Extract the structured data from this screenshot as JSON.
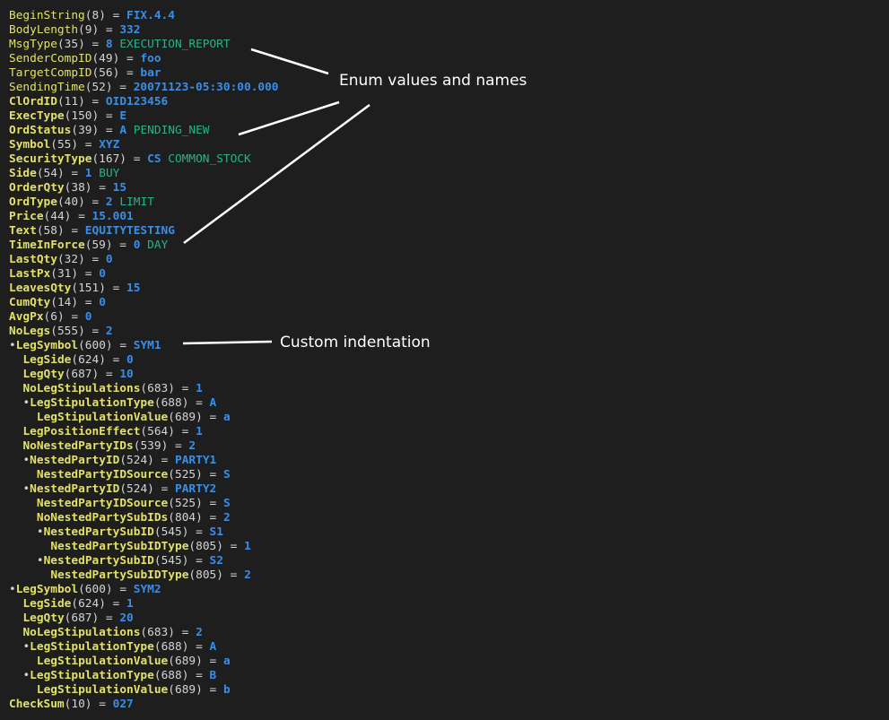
{
  "lines": [
    {
      "indent": 0,
      "bullet": false,
      "bold": false,
      "tag": "BeginString",
      "num": "8",
      "value": "FIX.4.4",
      "ename": ""
    },
    {
      "indent": 0,
      "bullet": false,
      "bold": false,
      "tag": "BodyLength",
      "num": "9",
      "value": "332",
      "ename": ""
    },
    {
      "indent": 0,
      "bullet": false,
      "bold": false,
      "tag": "MsgType",
      "num": "35",
      "value": "8",
      "ename": "EXECUTION_REPORT"
    },
    {
      "indent": 0,
      "bullet": false,
      "bold": false,
      "tag": "SenderCompID",
      "num": "49",
      "value": "foo",
      "ename": ""
    },
    {
      "indent": 0,
      "bullet": false,
      "bold": false,
      "tag": "TargetCompID",
      "num": "56",
      "value": "bar",
      "ename": ""
    },
    {
      "indent": 0,
      "bullet": false,
      "bold": false,
      "tag": "SendingTime",
      "num": "52",
      "value": "20071123-05:30:00.000",
      "ename": ""
    },
    {
      "indent": 0,
      "bullet": false,
      "bold": true,
      "tag": "ClOrdID",
      "num": "11",
      "value": "OID123456",
      "ename": ""
    },
    {
      "indent": 0,
      "bullet": false,
      "bold": true,
      "tag": "ExecType",
      "num": "150",
      "value": "E",
      "ename": ""
    },
    {
      "indent": 0,
      "bullet": false,
      "bold": true,
      "tag": "OrdStatus",
      "num": "39",
      "value": "A",
      "ename": "PENDING_NEW"
    },
    {
      "indent": 0,
      "bullet": false,
      "bold": true,
      "tag": "Symbol",
      "num": "55",
      "value": "XYZ",
      "ename": ""
    },
    {
      "indent": 0,
      "bullet": false,
      "bold": true,
      "tag": "SecurityType",
      "num": "167",
      "value": "CS",
      "ename": "COMMON_STOCK"
    },
    {
      "indent": 0,
      "bullet": false,
      "bold": true,
      "tag": "Side",
      "num": "54",
      "value": "1",
      "ename": "BUY"
    },
    {
      "indent": 0,
      "bullet": false,
      "bold": true,
      "tag": "OrderQty",
      "num": "38",
      "value": "15",
      "ename": ""
    },
    {
      "indent": 0,
      "bullet": false,
      "bold": true,
      "tag": "OrdType",
      "num": "40",
      "value": "2",
      "ename": "LIMIT"
    },
    {
      "indent": 0,
      "bullet": false,
      "bold": true,
      "tag": "Price",
      "num": "44",
      "value": "15.001",
      "ename": ""
    },
    {
      "indent": 0,
      "bullet": false,
      "bold": true,
      "tag": "Text",
      "num": "58",
      "value": "EQUITYTESTING",
      "ename": ""
    },
    {
      "indent": 0,
      "bullet": false,
      "bold": true,
      "tag": "TimeInForce",
      "num": "59",
      "value": "0",
      "ename": "DAY"
    },
    {
      "indent": 0,
      "bullet": false,
      "bold": true,
      "tag": "LastQty",
      "num": "32",
      "value": "0",
      "ename": ""
    },
    {
      "indent": 0,
      "bullet": false,
      "bold": true,
      "tag": "LastPx",
      "num": "31",
      "value": "0",
      "ename": ""
    },
    {
      "indent": 0,
      "bullet": false,
      "bold": true,
      "tag": "LeavesQty",
      "num": "151",
      "value": "15",
      "ename": ""
    },
    {
      "indent": 0,
      "bullet": false,
      "bold": true,
      "tag": "CumQty",
      "num": "14",
      "value": "0",
      "ename": ""
    },
    {
      "indent": 0,
      "bullet": false,
      "bold": true,
      "tag": "AvgPx",
      "num": "6",
      "value": "0",
      "ename": ""
    },
    {
      "indent": 0,
      "bullet": false,
      "bold": true,
      "tag": "NoLegs",
      "num": "555",
      "value": "2",
      "ename": ""
    },
    {
      "indent": 1,
      "bullet": true,
      "bold": true,
      "tag": "LegSymbol",
      "num": "600",
      "value": "SYM1",
      "ename": ""
    },
    {
      "indent": 2,
      "bullet": false,
      "bold": true,
      "tag": "LegSide",
      "num": "624",
      "value": "0",
      "ename": ""
    },
    {
      "indent": 2,
      "bullet": false,
      "bold": true,
      "tag": "LegQty",
      "num": "687",
      "value": "10",
      "ename": ""
    },
    {
      "indent": 2,
      "bullet": false,
      "bold": true,
      "tag": "NoLegStipulations",
      "num": "683",
      "value": "1",
      "ename": ""
    },
    {
      "indent": 3,
      "bullet": true,
      "bold": true,
      "tag": "LegStipulationType",
      "num": "688",
      "value": "A",
      "ename": ""
    },
    {
      "indent": 4,
      "bullet": false,
      "bold": true,
      "tag": "LegStipulationValue",
      "num": "689",
      "value": "a",
      "ename": ""
    },
    {
      "indent": 2,
      "bullet": false,
      "bold": true,
      "tag": "LegPositionEffect",
      "num": "564",
      "value": "1",
      "ename": ""
    },
    {
      "indent": 2,
      "bullet": false,
      "bold": true,
      "tag": "NoNestedPartyIDs",
      "num": "539",
      "value": "2",
      "ename": ""
    },
    {
      "indent": 3,
      "bullet": true,
      "bold": true,
      "tag": "NestedPartyID",
      "num": "524",
      "value": "PARTY1",
      "ename": ""
    },
    {
      "indent": 4,
      "bullet": false,
      "bold": true,
      "tag": "NestedPartyIDSource",
      "num": "525",
      "value": "S",
      "ename": ""
    },
    {
      "indent": 3,
      "bullet": true,
      "bold": true,
      "tag": "NestedPartyID",
      "num": "524",
      "value": "PARTY2",
      "ename": ""
    },
    {
      "indent": 4,
      "bullet": false,
      "bold": true,
      "tag": "NestedPartyIDSource",
      "num": "525",
      "value": "S",
      "ename": ""
    },
    {
      "indent": 4,
      "bullet": false,
      "bold": true,
      "tag": "NoNestedPartySubIDs",
      "num": "804",
      "value": "2",
      "ename": ""
    },
    {
      "indent": 5,
      "bullet": true,
      "bold": true,
      "tag": "NestedPartySubID",
      "num": "545",
      "value": "S1",
      "ename": ""
    },
    {
      "indent": 6,
      "bullet": false,
      "bold": true,
      "tag": "NestedPartySubIDType",
      "num": "805",
      "value": "1",
      "ename": ""
    },
    {
      "indent": 5,
      "bullet": true,
      "bold": true,
      "tag": "NestedPartySubID",
      "num": "545",
      "value": "S2",
      "ename": ""
    },
    {
      "indent": 6,
      "bullet": false,
      "bold": true,
      "tag": "NestedPartySubIDType",
      "num": "805",
      "value": "2",
      "ename": ""
    },
    {
      "indent": 1,
      "bullet": true,
      "bold": true,
      "tag": "LegSymbol",
      "num": "600",
      "value": "SYM2",
      "ename": ""
    },
    {
      "indent": 2,
      "bullet": false,
      "bold": true,
      "tag": "LegSide",
      "num": "624",
      "value": "1",
      "ename": ""
    },
    {
      "indent": 2,
      "bullet": false,
      "bold": true,
      "tag": "LegQty",
      "num": "687",
      "value": "20",
      "ename": ""
    },
    {
      "indent": 2,
      "bullet": false,
      "bold": true,
      "tag": "NoLegStipulations",
      "num": "683",
      "value": "2",
      "ename": ""
    },
    {
      "indent": 3,
      "bullet": true,
      "bold": true,
      "tag": "LegStipulationType",
      "num": "688",
      "value": "A",
      "ename": ""
    },
    {
      "indent": 4,
      "bullet": false,
      "bold": true,
      "tag": "LegStipulationValue",
      "num": "689",
      "value": "a",
      "ename": ""
    },
    {
      "indent": 3,
      "bullet": true,
      "bold": true,
      "tag": "LegStipulationType",
      "num": "688",
      "value": "B",
      "ename": ""
    },
    {
      "indent": 4,
      "bullet": false,
      "bold": true,
      "tag": "LegStipulationValue",
      "num": "689",
      "value": "b",
      "ename": ""
    },
    {
      "indent": 0,
      "bullet": false,
      "bold": true,
      "tag": "CheckSum",
      "num": "10",
      "value": "027",
      "ename": ""
    }
  ],
  "annotations": {
    "enum_label": "Enum values and names",
    "indent_label": "Custom indentation"
  },
  "colors": {
    "background": "#1e1e1e",
    "tag": "#e2e26a",
    "value": "#3a8ee6",
    "enum_name": "#27b38c",
    "plain": "#d4d4d4",
    "annotation": "#ffffff"
  }
}
